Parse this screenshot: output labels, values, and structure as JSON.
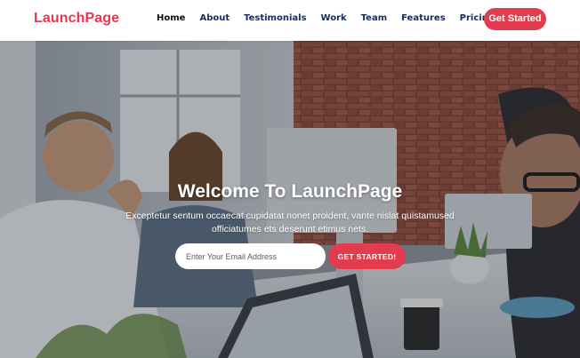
{
  "brand": {
    "name": "LaunchPage",
    "color": "#e8364f"
  },
  "nav": {
    "items": [
      {
        "label": "Home",
        "active": true
      },
      {
        "label": "About",
        "active": false
      },
      {
        "label": "Testimonials",
        "active": false
      },
      {
        "label": "Work",
        "active": false
      },
      {
        "label": "Team",
        "active": false
      },
      {
        "label": "Features",
        "active": false
      },
      {
        "label": "Pricing",
        "active": false
      }
    ],
    "cta_label": "Get Started"
  },
  "hero": {
    "title": "Welcome To LaunchPage",
    "subtitle": "Exceptetur sentum occaecat cupidatat nonet proident, vante nislat quistamused officiatumes ets deserunt etimus nets.",
    "email_placeholder": "Enter Your Email Address",
    "cta_label": "GET STARTED!",
    "background": "office-team-photo"
  },
  "colors": {
    "accent": "#e23c4f",
    "nav_text": "#1a2b5a"
  }
}
